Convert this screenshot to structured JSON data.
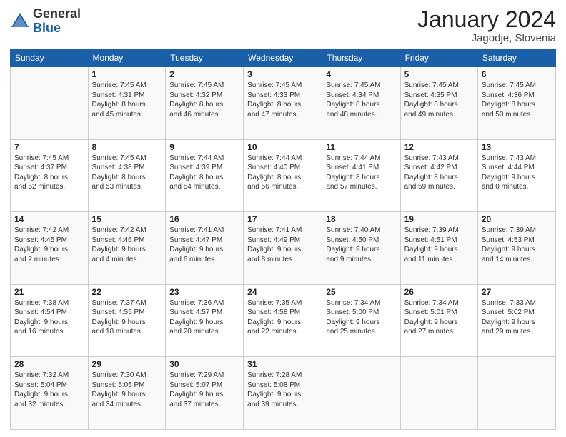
{
  "logo": {
    "general": "General",
    "blue": "Blue"
  },
  "title": "January 2024",
  "location": "Jagodje, Slovenia",
  "weekdays": [
    "Sunday",
    "Monday",
    "Tuesday",
    "Wednesday",
    "Thursday",
    "Friday",
    "Saturday"
  ],
  "weeks": [
    [
      {
        "day": "",
        "sunrise": "",
        "sunset": "",
        "daylight": ""
      },
      {
        "day": "1",
        "sunrise": "Sunrise: 7:45 AM",
        "sunset": "Sunset: 4:31 PM",
        "daylight": "Daylight: 8 hours and 45 minutes."
      },
      {
        "day": "2",
        "sunrise": "Sunrise: 7:45 AM",
        "sunset": "Sunset: 4:32 PM",
        "daylight": "Daylight: 8 hours and 46 minutes."
      },
      {
        "day": "3",
        "sunrise": "Sunrise: 7:45 AM",
        "sunset": "Sunset: 4:33 PM",
        "daylight": "Daylight: 8 hours and 47 minutes."
      },
      {
        "day": "4",
        "sunrise": "Sunrise: 7:45 AM",
        "sunset": "Sunset: 4:34 PM",
        "daylight": "Daylight: 8 hours and 48 minutes."
      },
      {
        "day": "5",
        "sunrise": "Sunrise: 7:45 AM",
        "sunset": "Sunset: 4:35 PM",
        "daylight": "Daylight: 8 hours and 49 minutes."
      },
      {
        "day": "6",
        "sunrise": "Sunrise: 7:45 AM",
        "sunset": "Sunset: 4:36 PM",
        "daylight": "Daylight: 8 hours and 50 minutes."
      }
    ],
    [
      {
        "day": "7",
        "sunrise": "Sunrise: 7:45 AM",
        "sunset": "Sunset: 4:37 PM",
        "daylight": "Daylight: 8 hours and 52 minutes."
      },
      {
        "day": "8",
        "sunrise": "Sunrise: 7:45 AM",
        "sunset": "Sunset: 4:38 PM",
        "daylight": "Daylight: 8 hours and 53 minutes."
      },
      {
        "day": "9",
        "sunrise": "Sunrise: 7:44 AM",
        "sunset": "Sunset: 4:39 PM",
        "daylight": "Daylight: 8 hours and 54 minutes."
      },
      {
        "day": "10",
        "sunrise": "Sunrise: 7:44 AM",
        "sunset": "Sunset: 4:40 PM",
        "daylight": "Daylight: 8 hours and 56 minutes."
      },
      {
        "day": "11",
        "sunrise": "Sunrise: 7:44 AM",
        "sunset": "Sunset: 4:41 PM",
        "daylight": "Daylight: 8 hours and 57 minutes."
      },
      {
        "day": "12",
        "sunrise": "Sunrise: 7:43 AM",
        "sunset": "Sunset: 4:42 PM",
        "daylight": "Daylight: 8 hours and 59 minutes."
      },
      {
        "day": "13",
        "sunrise": "Sunrise: 7:43 AM",
        "sunset": "Sunset: 4:44 PM",
        "daylight": "Daylight: 9 hours and 0 minutes."
      }
    ],
    [
      {
        "day": "14",
        "sunrise": "Sunrise: 7:42 AM",
        "sunset": "Sunset: 4:45 PM",
        "daylight": "Daylight: 9 hours and 2 minutes."
      },
      {
        "day": "15",
        "sunrise": "Sunrise: 7:42 AM",
        "sunset": "Sunset: 4:46 PM",
        "daylight": "Daylight: 9 hours and 4 minutes."
      },
      {
        "day": "16",
        "sunrise": "Sunrise: 7:41 AM",
        "sunset": "Sunset: 4:47 PM",
        "daylight": "Daylight: 9 hours and 6 minutes."
      },
      {
        "day": "17",
        "sunrise": "Sunrise: 7:41 AM",
        "sunset": "Sunset: 4:49 PM",
        "daylight": "Daylight: 9 hours and 8 minutes."
      },
      {
        "day": "18",
        "sunrise": "Sunrise: 7:40 AM",
        "sunset": "Sunset: 4:50 PM",
        "daylight": "Daylight: 9 hours and 9 minutes."
      },
      {
        "day": "19",
        "sunrise": "Sunrise: 7:39 AM",
        "sunset": "Sunset: 4:51 PM",
        "daylight": "Daylight: 9 hours and 11 minutes."
      },
      {
        "day": "20",
        "sunrise": "Sunrise: 7:39 AM",
        "sunset": "Sunset: 4:53 PM",
        "daylight": "Daylight: 9 hours and 14 minutes."
      }
    ],
    [
      {
        "day": "21",
        "sunrise": "Sunrise: 7:38 AM",
        "sunset": "Sunset: 4:54 PM",
        "daylight": "Daylight: 9 hours and 16 minutes."
      },
      {
        "day": "22",
        "sunrise": "Sunrise: 7:37 AM",
        "sunset": "Sunset: 4:55 PM",
        "daylight": "Daylight: 9 hours and 18 minutes."
      },
      {
        "day": "23",
        "sunrise": "Sunrise: 7:36 AM",
        "sunset": "Sunset: 4:57 PM",
        "daylight": "Daylight: 9 hours and 20 minutes."
      },
      {
        "day": "24",
        "sunrise": "Sunrise: 7:35 AM",
        "sunset": "Sunset: 4:58 PM",
        "daylight": "Daylight: 9 hours and 22 minutes."
      },
      {
        "day": "25",
        "sunrise": "Sunrise: 7:34 AM",
        "sunset": "Sunset: 5:00 PM",
        "daylight": "Daylight: 9 hours and 25 minutes."
      },
      {
        "day": "26",
        "sunrise": "Sunrise: 7:34 AM",
        "sunset": "Sunset: 5:01 PM",
        "daylight": "Daylight: 9 hours and 27 minutes."
      },
      {
        "day": "27",
        "sunrise": "Sunrise: 7:33 AM",
        "sunset": "Sunset: 5:02 PM",
        "daylight": "Daylight: 9 hours and 29 minutes."
      }
    ],
    [
      {
        "day": "28",
        "sunrise": "Sunrise: 7:32 AM",
        "sunset": "Sunset: 5:04 PM",
        "daylight": "Daylight: 9 hours and 32 minutes."
      },
      {
        "day": "29",
        "sunrise": "Sunrise: 7:30 AM",
        "sunset": "Sunset: 5:05 PM",
        "daylight": "Daylight: 9 hours and 34 minutes."
      },
      {
        "day": "30",
        "sunrise": "Sunrise: 7:29 AM",
        "sunset": "Sunset: 5:07 PM",
        "daylight": "Daylight: 9 hours and 37 minutes."
      },
      {
        "day": "31",
        "sunrise": "Sunrise: 7:28 AM",
        "sunset": "Sunset: 5:08 PM",
        "daylight": "Daylight: 9 hours and 39 minutes."
      },
      {
        "day": "",
        "sunrise": "",
        "sunset": "",
        "daylight": ""
      },
      {
        "day": "",
        "sunrise": "",
        "sunset": "",
        "daylight": ""
      },
      {
        "day": "",
        "sunrise": "",
        "sunset": "",
        "daylight": ""
      }
    ]
  ]
}
